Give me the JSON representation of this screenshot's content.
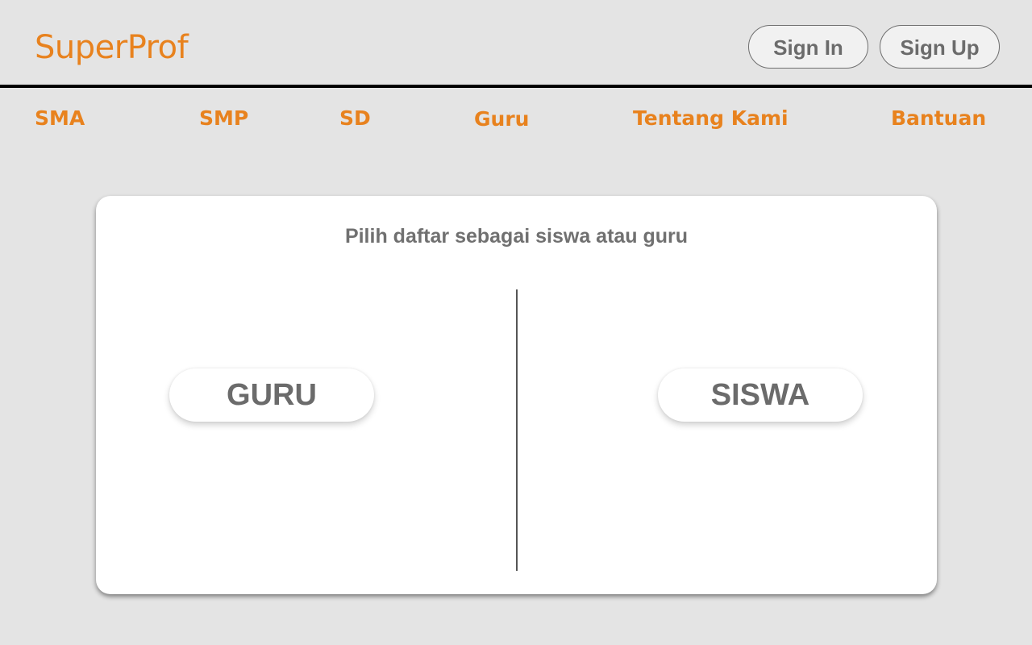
{
  "header": {
    "logo": "SuperProf",
    "sign_in_label": "Sign In",
    "sign_up_label": "Sign Up"
  },
  "nav": {
    "items": [
      {
        "label": "SMA"
      },
      {
        "label": "SMP"
      },
      {
        "label": "SD"
      },
      {
        "label": "Guru"
      },
      {
        "label": "Tentang Kami"
      },
      {
        "label": "Bantuan"
      }
    ]
  },
  "card": {
    "title": "Pilih daftar sebagai siswa atau guru",
    "guru_label": "GURU",
    "siswa_label": "SISWA"
  },
  "colors": {
    "accent": "#e8821e",
    "background": "#e4e4e4",
    "text_gray": "#6b6b6b",
    "card": "#ffffff"
  }
}
